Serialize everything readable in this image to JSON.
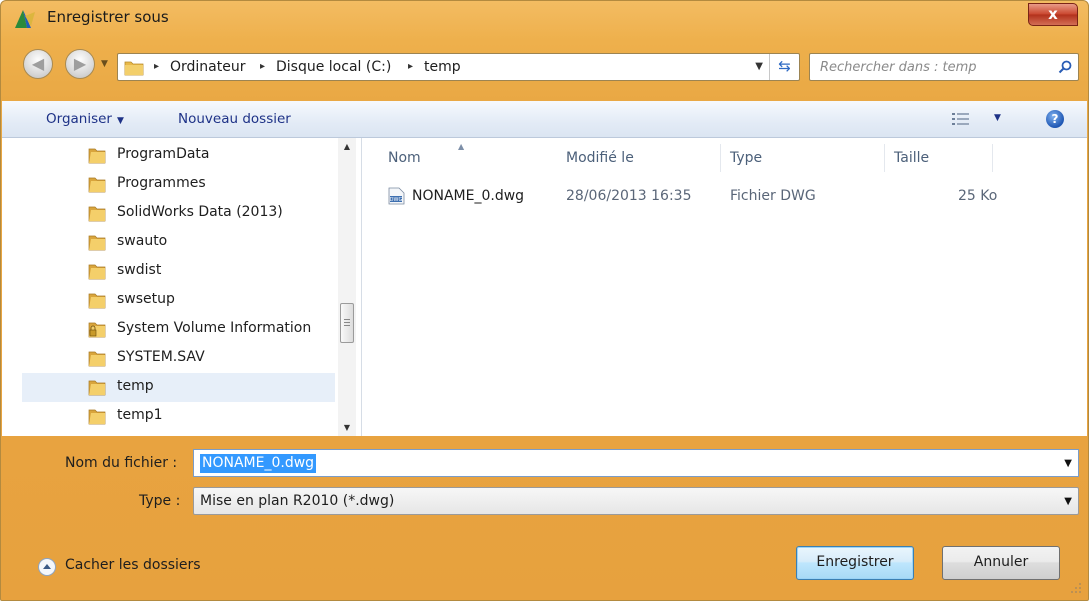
{
  "window": {
    "title": "Enregistrer sous",
    "close_label": "x",
    "accent": "#eeb04c"
  },
  "address": {
    "crumbs": [
      "Ordinateur",
      "Disque local (C:)",
      "temp"
    ],
    "separator": "▸"
  },
  "search": {
    "placeholder": "Rechercher dans : temp"
  },
  "toolbar": {
    "organize_label": "Organiser",
    "new_folder_label": "Nouveau dossier",
    "help_label": "?"
  },
  "tree": {
    "items": [
      {
        "label": "ProgramData",
        "icon": "folder-icon"
      },
      {
        "label": "Programmes",
        "icon": "folder-icon"
      },
      {
        "label": "SolidWorks Data (2013)",
        "icon": "folder-icon"
      },
      {
        "label": "swauto",
        "icon": "folder-icon"
      },
      {
        "label": "swdist",
        "icon": "folder-icon"
      },
      {
        "label": "swsetup",
        "icon": "folder-icon"
      },
      {
        "label": "System Volume Information",
        "icon": "locked-folder-icon"
      },
      {
        "label": "SYSTEM.SAV",
        "icon": "folder-icon"
      },
      {
        "label": "temp",
        "icon": "folder-icon",
        "selected": true
      },
      {
        "label": "temp1",
        "icon": "folder-icon"
      }
    ]
  },
  "files": {
    "columns": [
      "Nom",
      "Modifié le",
      "Type",
      "Taille"
    ],
    "rows": [
      {
        "name": "NONAME_0.dwg",
        "modified": "28/06/2013 16:35",
        "type": "Fichier DWG",
        "size": "25 Ko",
        "icon": "dwg-file-icon"
      }
    ]
  },
  "form": {
    "filename_label": "Nom du fichier :",
    "filename_value": "NONAME_0.dwg",
    "type_label": "Type :",
    "type_value": "Mise en plan R2010 (*.dwg)"
  },
  "footer": {
    "hide_folders_label": "Cacher les dossiers",
    "save_label": "Enregistrer",
    "cancel_label": "Annuler"
  }
}
